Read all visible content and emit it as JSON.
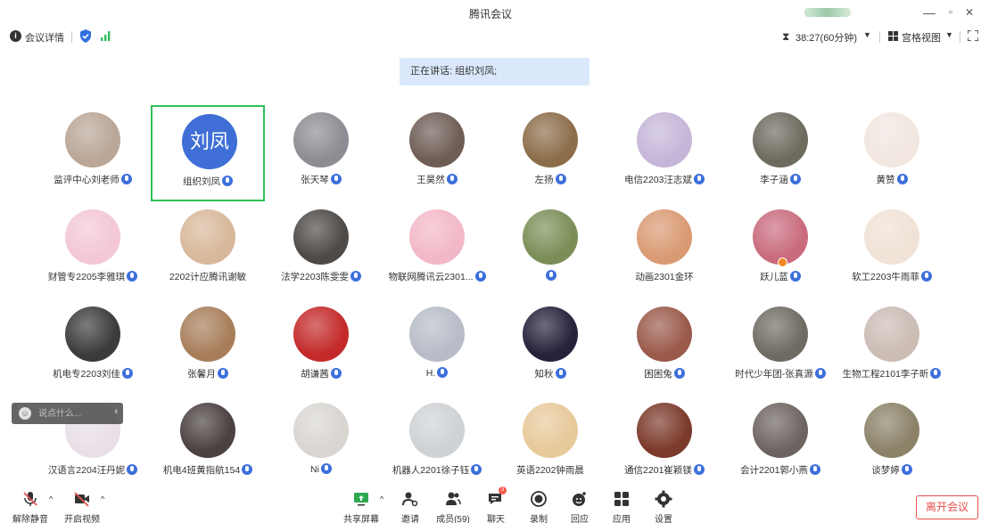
{
  "window": {
    "title": "腾讯会议",
    "controls": [
      "—",
      "▫",
      "✕"
    ]
  },
  "toolbar": {
    "meeting_info": "会议详情",
    "timer": "38:27(60分钟)",
    "view_mode": "宫格视图"
  },
  "speaking": "正在讲话: 组织刘凤;",
  "participants": [
    {
      "name": "监评中心刘老师",
      "avatar": "photo",
      "color": "#b9a697"
    },
    {
      "name": "组织刘凤",
      "avatar": "text",
      "text": "刘凤",
      "color": "#3f6fd6",
      "active": true
    },
    {
      "name": "张天琴",
      "avatar": "photo",
      "color": "#8c8d92"
    },
    {
      "name": "王昊然",
      "avatar": "photo",
      "color": "#6e5d55"
    },
    {
      "name": "左扬",
      "avatar": "photo",
      "color": "#8c6d4a"
    },
    {
      "name": "电信2203汪志斌",
      "avatar": "photo",
      "color": "#c5b6d9"
    },
    {
      "name": "李子涵",
      "avatar": "photo",
      "color": "#6d6a5e"
    },
    {
      "name": "黄赞",
      "avatar": "photo",
      "color": "#f1e6e0"
    },
    {
      "name": "财管专2205李雅琪",
      "avatar": "photo",
      "color": "#f3c7d6"
    },
    {
      "name": "2202计应腾讯谢敏",
      "avatar": "photo",
      "color": "#d8b89a",
      "nomic": true
    },
    {
      "name": "法学2203陈雯雯",
      "avatar": "photo",
      "color": "#4d4a47"
    },
    {
      "name": "物联网腾讯云2301...",
      "avatar": "photo",
      "color": "#f2b8c8"
    },
    {
      "name": "",
      "avatar": "photo",
      "color": "#7b8e57"
    },
    {
      "name": "动画2301金环",
      "avatar": "photo",
      "color": "#d99a73",
      "nomic": true
    },
    {
      "name": "跃儿蓝",
      "avatar": "photo",
      "color": "#c96b7d",
      "host": true
    },
    {
      "name": "软工2203牛雨菲",
      "avatar": "photo",
      "color": "#f0e2d6"
    },
    {
      "name": "机电专2203刘佳",
      "avatar": "photo",
      "color": "#3b3b3b"
    },
    {
      "name": "张馨月",
      "avatar": "photo",
      "color": "#a87e5a"
    },
    {
      "name": "胡谦茜",
      "avatar": "photo",
      "color": "#c42a2a"
    },
    {
      "name": "H.",
      "avatar": "photo",
      "color": "#b7bcc7"
    },
    {
      "name": "知秋",
      "avatar": "photo",
      "color": "#25223a"
    },
    {
      "name": "困困兔",
      "avatar": "photo",
      "color": "#9a5a4b"
    },
    {
      "name": "时代少年团-张真源",
      "avatar": "photo",
      "color": "#6f6b63"
    },
    {
      "name": "生物工程2101李子昕",
      "avatar": "photo",
      "color": "#cbbcb4"
    },
    {
      "name": "汉语言2204汪丹妮",
      "avatar": "photo",
      "color": "#e9dfe8"
    },
    {
      "name": "机电4班黄指航154",
      "avatar": "photo",
      "color": "#4a4140"
    },
    {
      "name": "Ni",
      "avatar": "photo",
      "color": "#d9d6d1"
    },
    {
      "name": "机器人2201徐子钰",
      "avatar": "photo",
      "color": "#cfd2d5"
    },
    {
      "name": "英语2202钟雨晨",
      "avatar": "photo",
      "color": "#e7c99a",
      "nomic": true
    },
    {
      "name": "通信2201崔颖镁",
      "avatar": "photo",
      "color": "#7b3a2b"
    },
    {
      "name": "会计2201郭小燕",
      "avatar": "photo",
      "color": "#6d6461"
    },
    {
      "name": "谈梦婷",
      "avatar": "photo",
      "color": "#8b8268"
    }
  ],
  "chat": {
    "placeholder": "说点什么..."
  },
  "bottom": {
    "unmute": "解除静音",
    "start_video": "开启视频",
    "share_screen": "共享屏幕",
    "invite": "邀请",
    "members": "成员(59)",
    "chat": "聊天",
    "record": "录制",
    "reaction": "回应",
    "apps": "应用",
    "settings": "设置",
    "leave": "离开会议",
    "chat_badge": "3"
  },
  "colors": {
    "accent": "#3d6fdc",
    "active_border": "#2fbf5a",
    "leave": "#e5514c",
    "banner": "#dbe8fb"
  }
}
